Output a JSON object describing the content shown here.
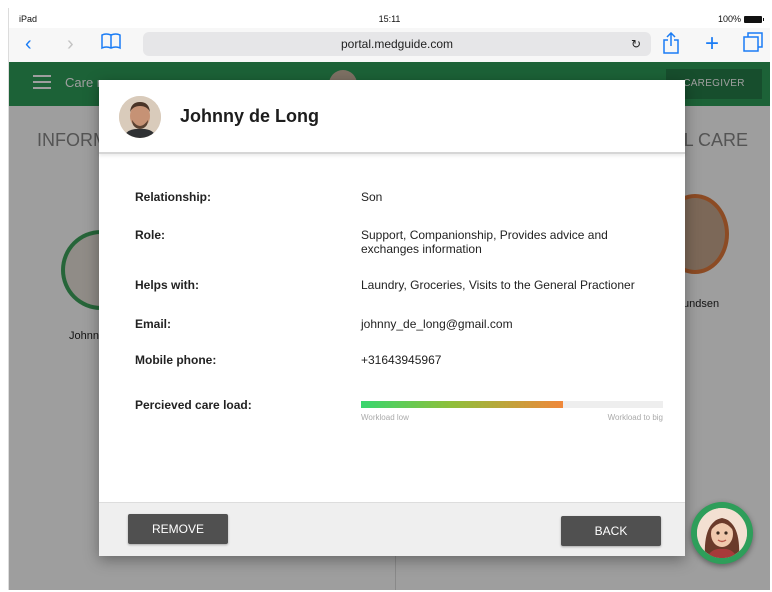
{
  "status_bar": {
    "device": "iPad",
    "time": "15:11",
    "battery": "100%"
  },
  "browser": {
    "url": "portal.medguide.com"
  },
  "app": {
    "title": "Care n",
    "caregiver_button": "CAREGIVER",
    "left_column_title": "INFORM",
    "right_column_title": "AL CARE",
    "left_person_name": "Johnn",
    "right_person_name": "undsen"
  },
  "modal": {
    "name": "Johnny de Long",
    "fields": {
      "relationship_label": "Relationship:",
      "relationship_value": "Son",
      "role_label": "Role:",
      "role_value": "Support, Companionship, Provides advice and exchanges information",
      "helps_label": "Helps with:",
      "helps_value": "Laundry, Groceries, Visits to the General Practioner",
      "email_label": "Email:",
      "email_value": "johnny_de_long@gmail.com",
      "phone_label": "Mobile phone:",
      "phone_value": "+31643945967",
      "load_label": "Percieved care load:",
      "load_low": "Workload low",
      "load_high": "Workload to big",
      "load_level": 0.67
    },
    "remove_button": "REMOVE",
    "back_button": "BACK"
  },
  "colors": {
    "app_green": "#2e9e5a",
    "button_dark": "#505050",
    "load_start": "#38d66e",
    "load_end": "#f0873a"
  }
}
